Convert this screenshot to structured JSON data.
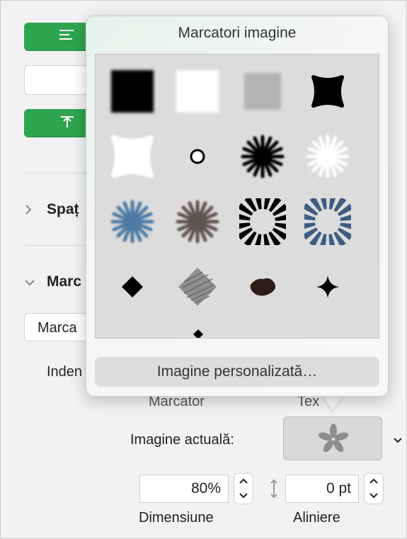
{
  "popover": {
    "title": "Marcatori imagine",
    "custom_image_button": "Imagine personalizată…",
    "bullet_images": [
      "black-square-blur-bullet-icon",
      "white-square-blur-bullet-icon",
      "gray-square-blur-bullet-icon",
      "black-flower-square-bullet-icon",
      "white-flower-square-bullet-icon",
      "small-ring-bullet-icon",
      "black-starburst-bullet-icon",
      "white-starburst-bullet-icon",
      "blue-starburst-bullet-icon",
      "brown-starburst-bullet-icon",
      "black-sunburst-bullet-icon",
      "blue-sunburst-bullet-icon",
      "black-diamond-bullet-icon",
      "sketch-diamond-bullet-icon",
      "brown-blob-bullet-icon",
      "black-sparkle-bullet-icon"
    ]
  },
  "sidebar": {
    "section_spacing": "Spaț",
    "section_bullets": "Marc",
    "bullet_type_select": "Marca",
    "indent_label": "Inden"
  },
  "bullet_settings": {
    "col_bullet": "Marcator",
    "col_text": "Tex",
    "current_image_label": "Imagine actuală:",
    "current_image_icon": "gray-asterisk-icon",
    "size_value": "80%",
    "size_label": "Dimensiune",
    "align_value": "0 pt",
    "align_label": "Aliniere"
  },
  "colors": {
    "accent_green": "#2ea44f",
    "bullet_blue": "#4e7aa5",
    "bullet_brown": "#5e534f"
  }
}
